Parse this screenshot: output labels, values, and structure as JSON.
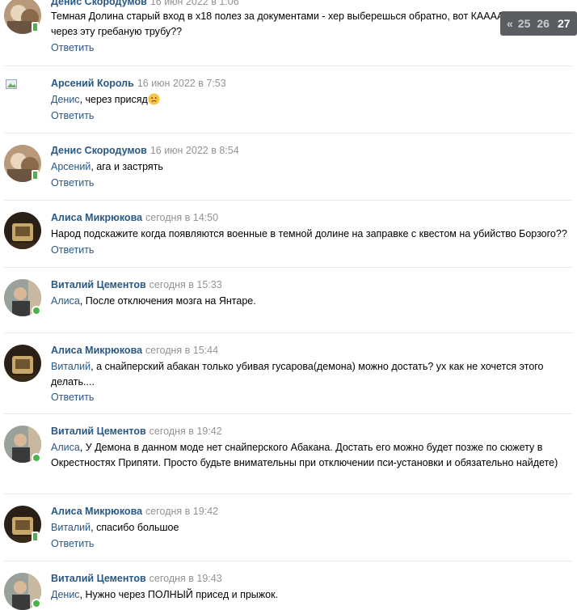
{
  "pager": {
    "prev": "«",
    "pages": [
      "25",
      "26"
    ],
    "current": "27"
  },
  "reply_label": "Ответить",
  "comments": [
    {
      "author": "Денис Скородумов",
      "date": "16 июн 2022 в 1:06",
      "mention": "",
      "text": "Темная Долина старый вход в х18 полез за документами - хер выберешься обратно, вот КААААК перелезть через эту гребаную трубу??"
    },
    {
      "author": "Арсений Король",
      "date": "16 июн 2022 в 7:53",
      "mention": "Денис",
      "text": ", через присяд"
    },
    {
      "author": "Денис Скородумов",
      "date": "16 июн 2022 в 8:54",
      "mention": "Арсений",
      "text": ", ага и застрять"
    },
    {
      "author": "Алиса Микрюкова",
      "date": "сегодня в 14:50",
      "mention": "",
      "text": "Народ подскажите когда появляются военные в темной долине на заправке с квестом на убийство Борзого??"
    },
    {
      "author": "Виталий Цементов",
      "date": "сегодня в 15:33",
      "mention": "Алиса",
      "text": ", После отключения мозга на Янтаре."
    },
    {
      "author": "Алиса Микрюкова",
      "date": "сегодня в 15:44",
      "mention": "Виталий",
      "text": ", а снайперский абакан только убивая гусарова(демона) можно достать? ух как не хочется этого делать...."
    },
    {
      "author": "Виталий Цементов",
      "date": "сегодня в 19:42",
      "mention": "Алиса",
      "text": ", У Демона в данном моде нет снайперского Абакана. Достать его можно будет позже по сюжету в Окрестностях Припяти. Просто будьте внимательны при отключении пси-установки и обязательно найдете)"
    },
    {
      "author": "Алиса Микрюкова",
      "date": "сегодня в 19:42",
      "mention": "Виталий",
      "text": ", спасибо большое"
    },
    {
      "author": "Виталий Цементов",
      "date": "сегодня в 19:43",
      "mention": "Денис",
      "text": ", Нужно через ПОЛНЫЙ присед и прыжок."
    }
  ],
  "colors": {
    "link": "#2a5885",
    "date": "#939393",
    "online": "#4bb34b",
    "separator": "#e7e8ec"
  }
}
